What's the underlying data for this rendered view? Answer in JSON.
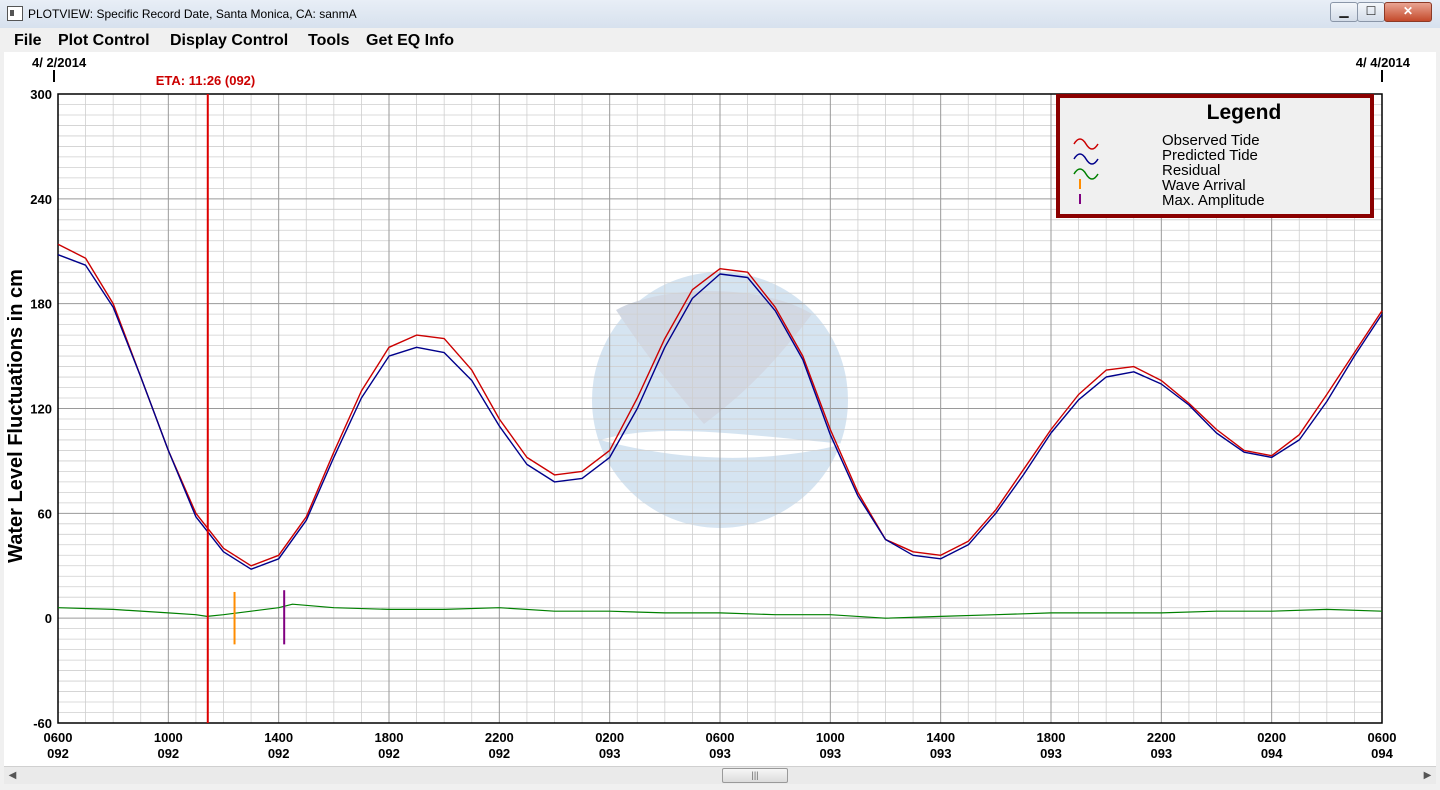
{
  "window": {
    "title": "PLOTVIEW: Specific Record Date, Santa Monica, CA: sanmA",
    "min_label": "▁",
    "max_label": "☐",
    "close_label": "✕"
  },
  "menu": {
    "file": "File",
    "plot_control": "Plot Control",
    "display_control": "Display Control",
    "tools": "Tools",
    "get_eq_info": "Get EQ Info"
  },
  "colors": {
    "observed": "#cc0000",
    "predicted": "#00008b",
    "residual": "#008000",
    "wave_arrival": "#ff8c00",
    "max_amplitude": "#800080",
    "eta_line": "#dd0000",
    "legend_border": "#8b0000",
    "grid": "#b8b8b8"
  },
  "chart_data": {
    "type": "line",
    "date_start": "4/ 2/2014",
    "date_end": "4/ 4/2014",
    "eta_label": "ETA: 11:26 (092)",
    "eta_hours": 5.43,
    "ylabel": "Water Level Fluctuations in cm",
    "ylim": [
      -60,
      300
    ],
    "xlim": [
      0,
      48
    ],
    "yticks": [
      300,
      240,
      180,
      120,
      60,
      0,
      -60
    ],
    "xticks": [
      {
        "hour": 0,
        "time": "0600",
        "day": "092"
      },
      {
        "hour": 4,
        "time": "1000",
        "day": "092"
      },
      {
        "hour": 8,
        "time": "1400",
        "day": "092"
      },
      {
        "hour": 12,
        "time": "1800",
        "day": "092"
      },
      {
        "hour": 16,
        "time": "2200",
        "day": "092"
      },
      {
        "hour": 20,
        "time": "0200",
        "day": "093"
      },
      {
        "hour": 24,
        "time": "0600",
        "day": "093"
      },
      {
        "hour": 28,
        "time": "1000",
        "day": "093"
      },
      {
        "hour": 32,
        "time": "1400",
        "day": "093"
      },
      {
        "hour": 36,
        "time": "1800",
        "day": "093"
      },
      {
        "hour": 40,
        "time": "2200",
        "day": "093"
      },
      {
        "hour": 44,
        "time": "0200",
        "day": "094"
      },
      {
        "hour": 48,
        "time": "0600",
        "day": "094"
      }
    ],
    "series": [
      {
        "name": "Observed Tide",
        "x": [
          0,
          1,
          2,
          3,
          4,
          5,
          6,
          7,
          8,
          9,
          10,
          11,
          12,
          13,
          14,
          15,
          16,
          17,
          18,
          19,
          20,
          21,
          22,
          23,
          24,
          25,
          26,
          27,
          28,
          29,
          30,
          31,
          32,
          33,
          34,
          35,
          36,
          37,
          38,
          39,
          40,
          41,
          42,
          43,
          44,
          45,
          46,
          47,
          48
        ],
        "y": [
          214,
          206,
          180,
          138,
          96,
          60,
          40,
          30,
          36,
          58,
          95,
          130,
          155,
          162,
          160,
          142,
          114,
          92,
          82,
          84,
          96,
          126,
          160,
          188,
          200,
          198,
          178,
          150,
          108,
          72,
          45,
          38,
          36,
          44,
          62,
          85,
          108,
          128,
          142,
          144,
          136,
          123,
          108,
          96,
          93,
          105,
          128,
          152,
          176
        ]
      },
      {
        "name": "Predicted Tide",
        "x": [
          0,
          1,
          2,
          3,
          4,
          5,
          6,
          7,
          8,
          9,
          10,
          11,
          12,
          13,
          14,
          15,
          16,
          17,
          18,
          19,
          20,
          21,
          22,
          23,
          24,
          25,
          26,
          27,
          28,
          29,
          30,
          31,
          32,
          33,
          34,
          35,
          36,
          37,
          38,
          39,
          40,
          41,
          42,
          43,
          44,
          45,
          46,
          47,
          48
        ],
        "y": [
          208,
          202,
          178,
          138,
          96,
          58,
          38,
          28,
          34,
          56,
          92,
          126,
          150,
          155,
          152,
          136,
          110,
          88,
          78,
          80,
          92,
          120,
          155,
          183,
          197,
          195,
          176,
          148,
          105,
          70,
          45,
          36,
          34,
          42,
          60,
          82,
          106,
          125,
          138,
          141,
          134,
          122,
          106,
          95,
          92,
          102,
          124,
          150,
          174
        ]
      },
      {
        "name": "Residual",
        "x": [
          0,
          2,
          4,
          5,
          5.4,
          6,
          7,
          8,
          8.5,
          10,
          12,
          14,
          16,
          18,
          20,
          22,
          24,
          26,
          28,
          30,
          32,
          34,
          36,
          38,
          40,
          42,
          44,
          46,
          48
        ],
        "y": [
          6,
          5,
          3,
          2,
          1,
          2,
          4,
          6,
          8,
          6,
          5,
          5,
          6,
          4,
          4,
          3,
          3,
          2,
          2,
          0,
          1,
          2,
          3,
          3,
          3,
          4,
          4,
          5,
          4
        ]
      }
    ],
    "markers": [
      {
        "name": "Wave Arrival",
        "hour": 6.4,
        "y_low": -15,
        "y_high": 15
      },
      {
        "name": "Max. Amplitude",
        "hour": 8.2,
        "y_low": -15,
        "y_high": 16
      }
    ],
    "legend": {
      "title": "Legend",
      "items": [
        "Observed Tide",
        "Predicted Tide",
        "Residual",
        "Wave Arrival",
        "Max. Amplitude"
      ],
      "placement": "top-right"
    },
    "grid": true
  }
}
